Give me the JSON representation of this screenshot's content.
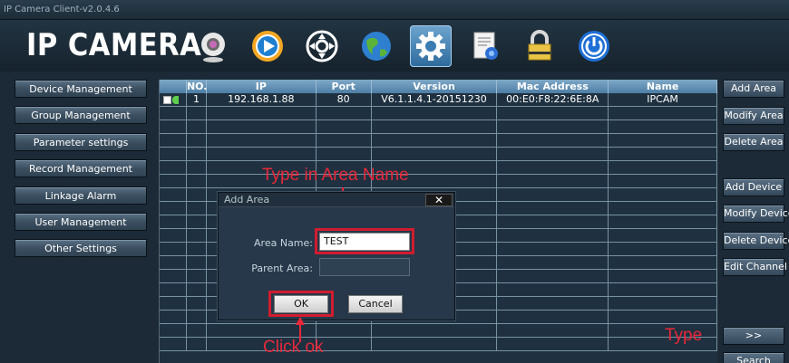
{
  "window": {
    "title": "IP Camera Client-v2.0.4.6"
  },
  "header": {
    "logo": "IP CAMERA",
    "toolbar": [
      {
        "icon": "webcam-icon",
        "active": false
      },
      {
        "icon": "play-icon",
        "active": false
      },
      {
        "icon": "ptz-control-icon",
        "active": false
      },
      {
        "icon": "globe-icon",
        "active": false
      },
      {
        "icon": "gear-icon",
        "active": true
      },
      {
        "icon": "log-document-icon",
        "active": false
      },
      {
        "icon": "lock-icon",
        "active": false
      },
      {
        "icon": "power-icon",
        "active": false
      }
    ]
  },
  "sidebar": {
    "items": [
      {
        "label": "Device Management"
      },
      {
        "label": "Group Management"
      },
      {
        "label": "Parameter settings"
      },
      {
        "label": "Record Management"
      },
      {
        "label": "Linkage Alarm"
      },
      {
        "label": "User Management"
      },
      {
        "label": "Other Settings"
      }
    ]
  },
  "table": {
    "columns": [
      "",
      "NO.",
      "IP",
      "Port",
      "Version",
      "Mac Address",
      "Name"
    ],
    "rows": [
      [
        "",
        "1",
        "192.168.1.88",
        "80",
        "V6.1.1.4.1-20151230",
        "00:E0:F8:22:6E:8A",
        "IPCAM"
      ]
    ],
    "empty_rows": 18
  },
  "right_buttons": {
    "add_area": "Add Area",
    "modify_area": "Modify Area",
    "delete_area": "Delete Area",
    "add_device": "Add Device",
    "modify_device": "Modify Device",
    "delete_device": "Delete Device",
    "edit_channel": "Edit Channel",
    "next": ">>",
    "search": "Search"
  },
  "dialog": {
    "title": "Add Area",
    "close": "✕",
    "area_name_label": "Area Name:",
    "area_name_value": "TEST",
    "parent_area_label": "Parent Area:",
    "parent_area_value": "",
    "ok": "OK",
    "cancel": "Cancel"
  },
  "annotations": {
    "type_area_name": "Type in Area Name",
    "click_ok": "Click ok",
    "type": "Type"
  },
  "colors": {
    "annotation_red": "#e8283a",
    "highlight_box": "#d11c2f",
    "header_blue": "#4d7ea5"
  }
}
